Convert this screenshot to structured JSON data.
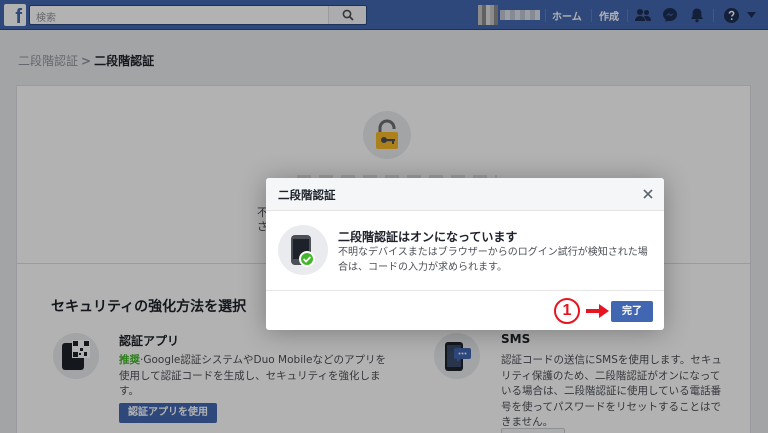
{
  "topbar": {
    "logo": "f",
    "search_placeholder": "検索",
    "nav_home": "ホーム",
    "nav_create": "作成"
  },
  "breadcrumb": {
    "parent": "二段階認証",
    "separator": ">",
    "current": "二段階認証"
  },
  "page": {
    "peek_line1": "不",
    "peek_line2": "さ",
    "section_title": "セキュリティの強化方法を選択",
    "methods": [
      {
        "name": "認証アプリ",
        "recommended": "推奨",
        "desc": "·Google認証システムやDuo Mobileなどのアプリを使用して認証コードを生成し、セキュリティを強化します。",
        "button": "認証アプリを使用"
      },
      {
        "name": "SMS",
        "desc": "認証コードの送信にSMSを使用します。セキュリティ保護のため、二段階認証がオンになっている場合は、二段階認証に使用している電話番号を使ってパスワードをリセットすることはできません。"
      }
    ]
  },
  "modal": {
    "title": "二段階認証",
    "heading": "二段階認証はオンになっています",
    "description": "不明なデバイスまたはブラウザーからのログイン試行が検知された場合は、コードの入力が求められます。",
    "done_button": "完了"
  },
  "annotation": {
    "number": "1"
  },
  "colors": {
    "brand": "#4267b2",
    "annotation": "#e8141f",
    "success": "#42b72a"
  }
}
